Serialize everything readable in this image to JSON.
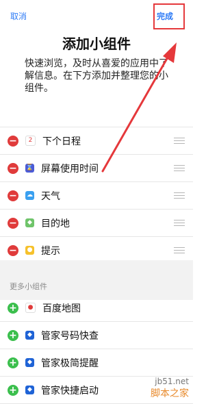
{
  "nav": {
    "cancel_label": "取消",
    "done_label": "完成"
  },
  "header": {
    "title": "添加小组件",
    "description": "快速浏览，及时从喜爱的应用中了解信息。在下方添加并整理您的小组件。"
  },
  "active_widgets": [
    {
      "label": "下个日程",
      "icon": "calendar-icon",
      "icon_text": "2",
      "icon_color": "#ffffff"
    },
    {
      "label": "屏幕使用时间",
      "icon": "hourglass-icon",
      "icon_text": "⌛",
      "icon_color": "#4b5bd6"
    },
    {
      "label": "天气",
      "icon": "weather-icon",
      "icon_text": "☁",
      "icon_color": "#3aa0f0"
    },
    {
      "label": "目的地",
      "icon": "maps-icon",
      "icon_text": "◆",
      "icon_color": "#6fc46a"
    },
    {
      "label": "提示",
      "icon": "tips-icon",
      "icon_text": "●",
      "icon_color": "#f6c12b"
    }
  ],
  "more_section": {
    "title": "更多小组件"
  },
  "more_widgets": [
    {
      "label": "百度地图",
      "icon": "baidu-map-icon",
      "icon_text": "●",
      "icon_color": "#ffffff"
    },
    {
      "label": "管家号码快查",
      "icon": "shield-icon",
      "icon_text": "◆",
      "icon_color": "#1f63d6"
    },
    {
      "label": "管家极简提醒",
      "icon": "shield-icon",
      "icon_text": "◆",
      "icon_color": "#1f63d6"
    },
    {
      "label": "管家快捷启动",
      "icon": "shield-icon",
      "icon_text": "◆",
      "icon_color": "#1f63d6"
    }
  ],
  "watermark": {
    "line1": "jb51.net",
    "line2": "脚本之家"
  },
  "colors": {
    "accent": "#2f7cf6",
    "remove": "#e03b3b",
    "add": "#3bbf4d",
    "annotation": "#e5383b"
  }
}
